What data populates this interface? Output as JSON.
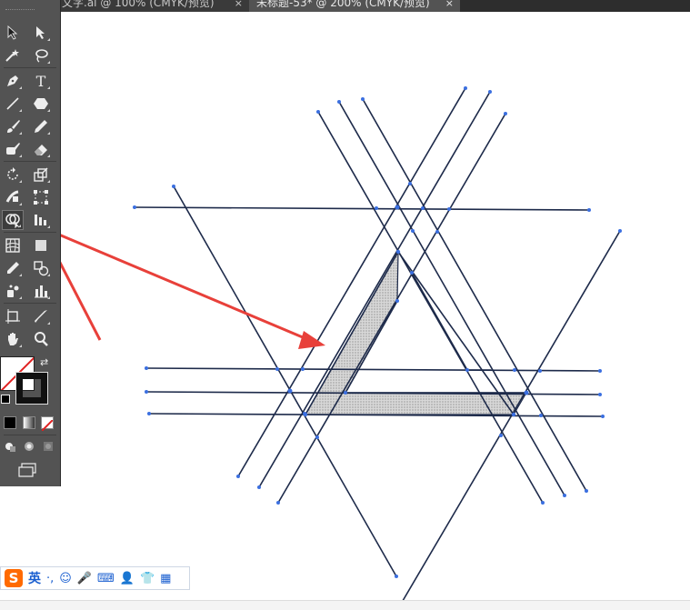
{
  "tabs": [
    {
      "label": "文字.ai @ 100% (CMYK/预览)",
      "close": "×",
      "active": false
    },
    {
      "label": "未标题-53* @ 200% (CMYK/预览)",
      "close": "×",
      "active": true
    }
  ],
  "toolbar": {
    "tools": [
      "selection-tool",
      "direct-selection-tool",
      "magic-wand-tool",
      "lasso-tool",
      "pen-tool",
      "type-tool",
      "line-segment-tool",
      "ellipse-tool",
      "paintbrush-tool",
      "pencil-tool",
      "blob-brush-tool",
      "eraser-tool",
      "rotate-tool",
      "scale-tool",
      "width-tool",
      "free-transform-tool",
      "shape-builder-tool",
      "perspective-grid-tool",
      "mesh-tool",
      "gradient-tool",
      "eyedropper-tool",
      "blend-tool",
      "symbol-sprayer-tool",
      "column-graph-tool",
      "artboard-tool",
      "slice-tool",
      "hand-tool",
      "zoom-tool"
    ],
    "type_glyph": "T",
    "fill_color": "#ffffff",
    "stroke_color": "#000000"
  },
  "ime_bar": {
    "logo": "S",
    "lang": "英",
    "punct": "·,",
    "icons": [
      "emoji-icon",
      "microphone-icon",
      "keyboard-icon",
      "user-icon",
      "shirt-icon",
      "grid-icon"
    ]
  },
  "colors": {
    "accent_red": "#e8403a",
    "line_navy": "#1d2a4a",
    "anchor_blue": "#3b6fe0",
    "toolbar_bg": "#535353"
  }
}
